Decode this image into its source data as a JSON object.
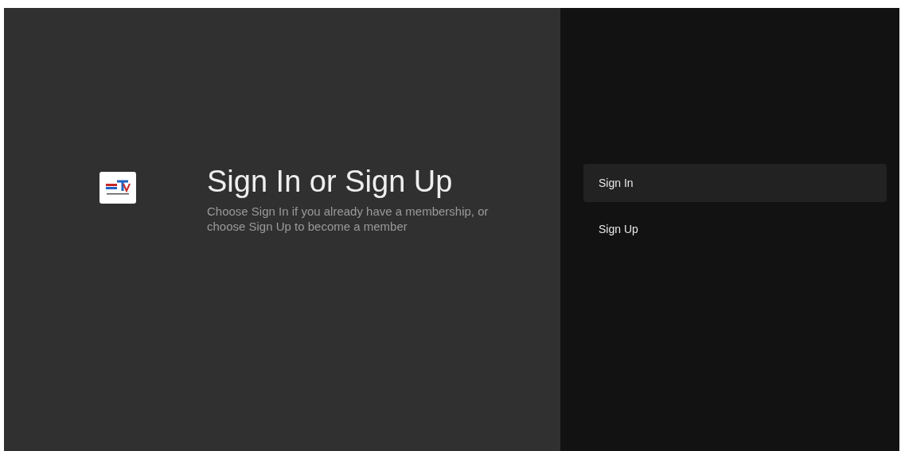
{
  "header": {
    "title": "Sign In or Sign Up",
    "description": "Choose Sign In if you already have a membership, or choose Sign Up to become a member"
  },
  "actions": [
    {
      "label": "Sign In",
      "selected": true
    },
    {
      "label": "Sign Up",
      "selected": false
    }
  ]
}
